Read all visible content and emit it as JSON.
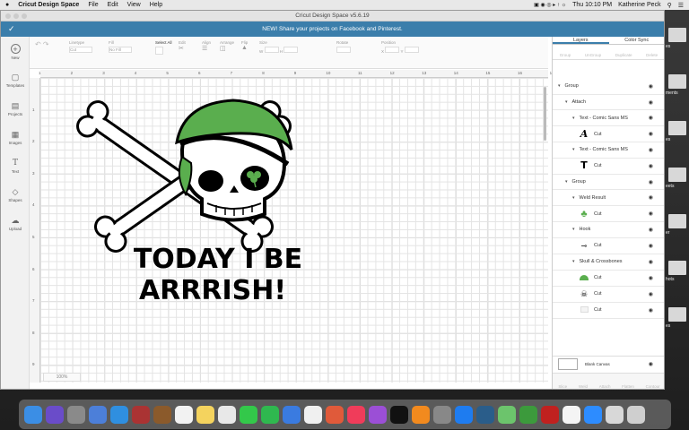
{
  "menubar": {
    "apple": "",
    "app": "Cricut Design Space",
    "items": [
      "File",
      "Edit",
      "View",
      "Help"
    ],
    "clock": "Thu 10:10 PM",
    "user": "Katherine Peck"
  },
  "window": {
    "title": "Cricut Design Space  v5.6.19"
  },
  "banner": {
    "text": "NEW! Share your projects on Facebook and Pinterest."
  },
  "toolbar": {
    "linetype": "Linetype",
    "linetype_value": "Cut",
    "fill": "Fill",
    "fill_value": "No Fill",
    "select_all": "Select All",
    "edit": "Edit",
    "align": "Align",
    "arrange": "Arrange",
    "flip": "Flip",
    "size": "Size",
    "size_w": "W",
    "size_h": "H",
    "rotate": "Rotate",
    "position": "Position",
    "pos_x": "X",
    "pos_y": "Y"
  },
  "sidebar": [
    {
      "label": "New",
      "icon": "plus-icon"
    },
    {
      "label": "Templates",
      "icon": "shirt-icon"
    },
    {
      "label": "Projects",
      "icon": "projects-icon"
    },
    {
      "label": "Images",
      "icon": "image-icon"
    },
    {
      "label": "Text",
      "icon": "text-icon"
    },
    {
      "label": "Shapes",
      "icon": "shapes-icon"
    },
    {
      "label": "Upload",
      "icon": "upload-icon"
    }
  ],
  "ruler": {
    "top": [
      "1",
      "2",
      "3",
      "4",
      "5",
      "6",
      "7",
      "8",
      "9",
      "10",
      "11",
      "12",
      "13",
      "14",
      "15",
      "16",
      "17"
    ],
    "left": [
      "1",
      "2",
      "3",
      "4",
      "5",
      "6",
      "7",
      "8",
      "9"
    ]
  },
  "canvas": {
    "text_line1": "TODAY I BE",
    "text_line2": "ARRRISH!"
  },
  "zoom": {
    "label": "100%"
  },
  "panel": {
    "tab_layers": "Layers",
    "tab_color_sync": "Color Sync",
    "tools": [
      "Group",
      "UnGroup",
      "Duplicate",
      "Delete"
    ],
    "layers": [
      {
        "label": "Group",
        "indent": 0,
        "type": "group",
        "eye": true
      },
      {
        "label": "Attach",
        "indent": 1,
        "type": "group",
        "eye": true
      },
      {
        "label": "Text - Comic Sans MS",
        "indent": 2,
        "type": "group",
        "eye": true
      },
      {
        "label": "Cut",
        "indent": 3,
        "type": "item",
        "thumb": "A",
        "eye": false
      },
      {
        "label": "Text - Comic Sans MS",
        "indent": 2,
        "type": "group",
        "eye": true
      },
      {
        "label": "Cut",
        "indent": 3,
        "type": "item",
        "thumb": "T",
        "eye": false
      },
      {
        "label": "Group",
        "indent": 1,
        "type": "group",
        "eye": true
      },
      {
        "label": "Weld Result",
        "indent": 2,
        "type": "group",
        "eye": true
      },
      {
        "label": "Cut",
        "indent": 3,
        "type": "item",
        "thumb": "clover",
        "eye": false
      },
      {
        "label": "Hook",
        "indent": 2,
        "type": "group",
        "eye": true
      },
      {
        "label": "Cut",
        "indent": 3,
        "type": "item",
        "thumb": "hook",
        "eye": false
      },
      {
        "label": "Skull & Crossbones",
        "indent": 2,
        "type": "group",
        "eye": true
      },
      {
        "label": "Cut",
        "indent": 3,
        "type": "item",
        "thumb": "bandana",
        "eye": true
      },
      {
        "label": "Cut",
        "indent": 3,
        "type": "item",
        "thumb": "skull",
        "eye": true
      },
      {
        "label": "Cut",
        "indent": 3,
        "type": "item",
        "thumb": "white",
        "eye": true
      }
    ],
    "blank_canvas": "Blank Canvas",
    "bottom_tools": [
      "Slice",
      "Weld",
      "Attach",
      "Flatten",
      "Contour"
    ]
  },
  "desktop_right": [
    "es",
    "ments",
    "es",
    "eets",
    "er",
    "hots",
    "es"
  ],
  "colors": {
    "banner": "#3b7eab",
    "bandana": "#5aae4e",
    "black": "#000000"
  },
  "dock": [
    {
      "icon": "finder-icon",
      "color": "#3b8ee5"
    },
    {
      "icon": "siri-icon",
      "color": "#6a4cc9"
    },
    {
      "icon": "launchpad-icon",
      "color": "#8a8a8a"
    },
    {
      "icon": "app-store-badge-icon",
      "color": "#4c7fd9"
    },
    {
      "icon": "safari-icon",
      "color": "#2f8fe0"
    },
    {
      "icon": "photo-booth-icon",
      "color": "#a33"
    },
    {
      "icon": "notes-brown-icon",
      "color": "#8b5a2b"
    },
    {
      "icon": "calendar-icon",
      "color": "#f2f2f2"
    },
    {
      "icon": "notes-icon",
      "color": "#f4d35e"
    },
    {
      "icon": "photos-icon",
      "color": "#e8e8e8"
    },
    {
      "icon": "messages-icon",
      "color": "#33c84a"
    },
    {
      "icon": "facetime-icon",
      "color": "#2fb84f"
    },
    {
      "icon": "keynote-icon",
      "color": "#3a7be0"
    },
    {
      "icon": "reminders-icon",
      "color": "#f0f0f0"
    },
    {
      "icon": "charts-icon",
      "color": "#e05a3a"
    },
    {
      "icon": "music-icon",
      "color": "#f03c5a"
    },
    {
      "icon": "podcasts-icon",
      "color": "#9b4fd6"
    },
    {
      "icon": "tv-icon",
      "color": "#111"
    },
    {
      "icon": "books-icon",
      "color": "#f28a1e"
    },
    {
      "icon": "system-preferences-icon",
      "color": "#888"
    },
    {
      "icon": "app-store-icon",
      "color": "#1e7cf0"
    },
    {
      "icon": "cricut-icon",
      "color": "#2a5d8a"
    },
    {
      "icon": "maps-icon",
      "color": "#6cc46c"
    },
    {
      "icon": "cricut-green-icon",
      "color": "#3c9a3c"
    },
    {
      "icon": "acrobat-icon",
      "color": "#c0211f"
    },
    {
      "icon": "chrome-icon",
      "color": "#f4f4f4"
    },
    {
      "icon": "zoom-icon",
      "color": "#2d8cff"
    },
    {
      "icon": "downloads-icon",
      "color": "#d8d8d8"
    },
    {
      "icon": "trash-icon",
      "color": "#cfcfcf"
    }
  ]
}
